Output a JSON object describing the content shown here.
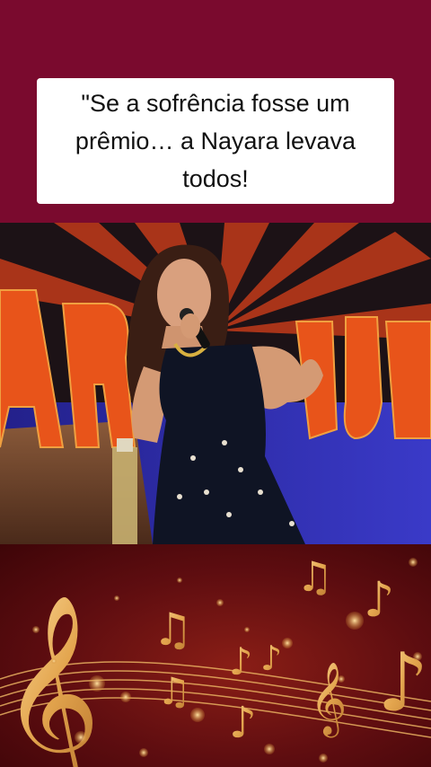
{
  "caption": {
    "text": "\"Se a sofrência fosse um prêmio… a Nayara levava todos!"
  },
  "colors": {
    "background": "#7a0a2e",
    "card": "#ffffff",
    "text": "#111111",
    "stage_orange": "#e8541a",
    "stage_blue": "#2b2fa8",
    "gold": "#e9b45a"
  },
  "icons": {
    "treble_clef": "treble-clef-icon",
    "notes": "music-note-icon"
  }
}
